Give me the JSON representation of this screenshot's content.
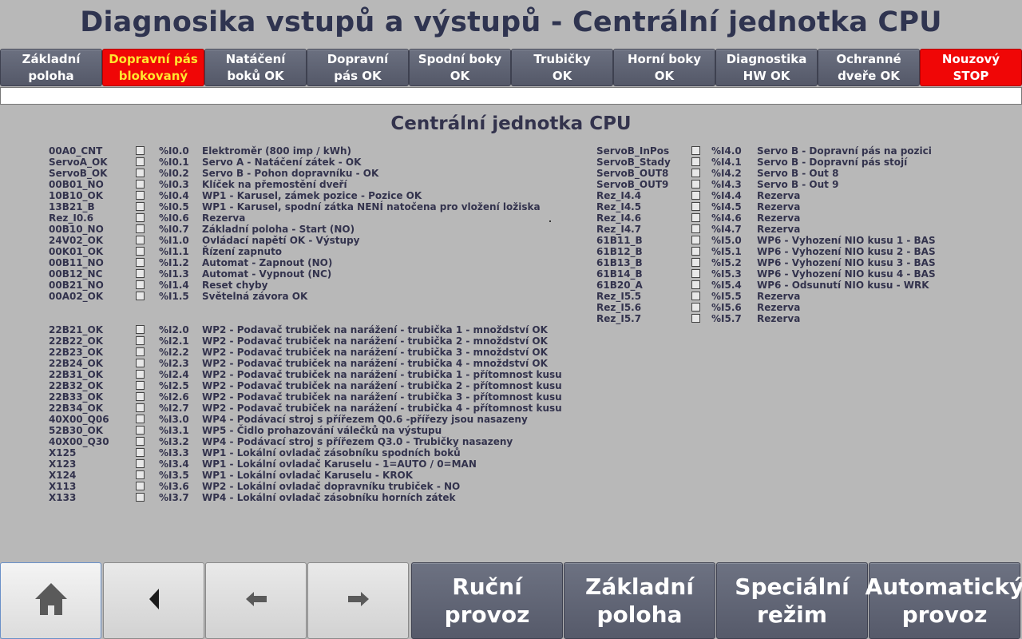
{
  "title": "Diagnosika vstupů a výstupů - Centrální jednotka CPU",
  "status_buttons": [
    {
      "label": "Základní\npoloha",
      "state": "normal"
    },
    {
      "label": "Dopravní pás\nblokovaný",
      "state": "warn"
    },
    {
      "label": "Natáčení\nboků OK",
      "state": "normal"
    },
    {
      "label": "Dopravní\npás OK",
      "state": "normal"
    },
    {
      "label": "Spodní boky\nOK",
      "state": "normal"
    },
    {
      "label": "Trubičky\nOK",
      "state": "normal"
    },
    {
      "label": "Horní boky\nOK",
      "state": "normal"
    },
    {
      "label": "Diagnostika\nHW OK",
      "state": "normal"
    },
    {
      "label": "Ochranné\ndveře OK",
      "state": "normal"
    },
    {
      "label": "Nouzový\nSTOP",
      "state": "stop"
    }
  ],
  "section_title": "Centrální jednotka CPU",
  "left_inputs_group1": [
    {
      "tag": "00A0_CNT",
      "address": "%I0.0",
      "description": "Elektroměr (800 imp / kWh)",
      "checked": false
    },
    {
      "tag": "ServoA_OK",
      "address": "%I0.1",
      "description": "Servo A - Natáčení zátek - OK",
      "checked": false
    },
    {
      "tag": "ServoB_OK",
      "address": "%I0.2",
      "description": "Servo B - Pohon dopravníku - OK",
      "checked": false
    },
    {
      "tag": "00B01_NO",
      "address": "%I0.3",
      "description": "Klíček na přemostění dveří",
      "checked": false
    },
    {
      "tag": "10B10_OK",
      "address": "%I0.4",
      "description": "WP1 - Karusel, zámek pozice - Pozice OK",
      "checked": false
    },
    {
      "tag": "13B21_B",
      "address": "%I0.5",
      "description": "WP1 - Karusel, spodní zátka NENÍ natočena pro vložení ložiska",
      "checked": false
    },
    {
      "tag": "Rez_I0.6",
      "address": "%I0.6",
      "description": "Rezerva",
      "checked": false
    },
    {
      "tag": "00B10_NO",
      "address": "%I0.7",
      "description": "Základní poloha - Start (NO)",
      "checked": false
    },
    {
      "tag": "24V02_OK",
      "address": "%I1.0",
      "description": "Ovládací napětí OK - Výstupy",
      "checked": false
    },
    {
      "tag": "00K01_OK",
      "address": "%I1.1",
      "description": "Řízení zapnuto",
      "checked": false
    },
    {
      "tag": "00B11_NO",
      "address": "%I1.2",
      "description": "Automat - Zapnout (NO)",
      "checked": false
    },
    {
      "tag": "00B12_NC",
      "address": "%I1.3",
      "description": "Automat - Vypnout (NC)",
      "checked": false
    },
    {
      "tag": "00B21_NO",
      "address": "%I1.4",
      "description": "Reset chyby",
      "checked": false
    },
    {
      "tag": "00A02_OK",
      "address": "%I1.5",
      "description": "Světelná závora OK",
      "checked": false
    }
  ],
  "left_inputs_group2": [
    {
      "tag": "22B21_OK",
      "address": "%I2.0",
      "description": "WP2 - Podavač trubiček na narážení - trubička 1 - množdství OK",
      "checked": false
    },
    {
      "tag": "22B22_OK",
      "address": "%I2.1",
      "description": "WP2 - Podavač trubiček na narážení - trubička 2 - množdství OK",
      "checked": false
    },
    {
      "tag": "22B23_OK",
      "address": "%I2.2",
      "description": "WP2 - Podavač trubiček na narážení - trubička 3 - množdství OK",
      "checked": false
    },
    {
      "tag": "22B24_OK",
      "address": "%I2.3",
      "description": "WP2 - Podavač trubiček na narážení - trubička 4 - množdství OK",
      "checked": false
    },
    {
      "tag": "22B31_OK",
      "address": "%I2.4",
      "description": "WP2 - Podavač trubiček na narážení - trubička 1 - přítomnost kusu",
      "checked": false
    },
    {
      "tag": "22B32_OK",
      "address": "%I2.5",
      "description": "WP2 - Podavač trubiček na narážení - trubička 2 - přítomnost kusu",
      "checked": false
    },
    {
      "tag": "22B33_OK",
      "address": "%I2.6",
      "description": "WP2 - Podavač trubiček na narážení - trubička 3 - přítomnost kusu",
      "checked": false
    },
    {
      "tag": "22B34_OK",
      "address": "%I2.7",
      "description": "WP2 - Podavač trubiček na narážení - trubička 4 - přítomnost kusu",
      "checked": false
    },
    {
      "tag": "40X00_Q06",
      "address": "%I3.0",
      "description": "WP4 - Podávací stroj s přířezem Q0.6 -přířezy jsou nasazeny",
      "checked": false
    },
    {
      "tag": "52B30_OK",
      "address": "%I3.1",
      "description": "WP5 - Čidlo prohazování válečků na výstupu",
      "checked": false
    },
    {
      "tag": "40X00_Q30",
      "address": "%I3.2",
      "description": "WP4 - Podávací stroj s přířezem Q3.0 - Trubičky nasazeny",
      "checked": false
    },
    {
      "tag": "X125",
      "address": "%I3.3",
      "description": "WP1 - Lokální ovladač zásobníku spodních boků",
      "checked": false
    },
    {
      "tag": "X123",
      "address": "%I3.4",
      "description": "WP1 - Lokální ovladač Karuselu - 1=AUTO / 0=MAN",
      "checked": false
    },
    {
      "tag": "X124",
      "address": "%I3.5",
      "description": "WP1 - Lokální ovladač Karuselu - KROK",
      "checked": false
    },
    {
      "tag": "X113",
      "address": "%I3.6",
      "description": "WP2 - Lokální ovladač dopravníku trubiček - NO",
      "checked": false
    },
    {
      "tag": "X133",
      "address": "%I3.7",
      "description": "WP4 - Lokální ovladač zásobníku horních zátek",
      "checked": false
    }
  ],
  "right_inputs": [
    {
      "tag": "ServoB_InPos",
      "address": "%I4.0",
      "description": "Servo B - Dopravní pás na pozici",
      "checked": false
    },
    {
      "tag": "ServoB_Stady",
      "address": "%I4.1",
      "description": "Servo B - Dopravní pás stojí",
      "checked": false
    },
    {
      "tag": "ServoB_OUT8",
      "address": "%I4.2",
      "description": "Servo B - Out 8",
      "checked": false
    },
    {
      "tag": "ServoB_OUT9",
      "address": "%I4.3",
      "description": "Servo B - Out 9",
      "checked": false
    },
    {
      "tag": "Rez_I4.4",
      "address": "%I4.4",
      "description": "Rezerva",
      "checked": false
    },
    {
      "tag": "Rez_I4.5",
      "address": "%I4.5",
      "description": "Rezerva",
      "checked": false
    },
    {
      "tag": "Rez_I4.6",
      "address": "%I4.6",
      "description": "Rezerva",
      "checked": false
    },
    {
      "tag": "Rez_I4.7",
      "address": "%I4.7",
      "description": "Rezerva",
      "checked": false
    },
    {
      "tag": "61B11_B",
      "address": "%I5.0",
      "description": "WP6 - Vyhození NIO kusu 1 - BAS",
      "checked": false
    },
    {
      "tag": "61B12_B",
      "address": "%I5.1",
      "description": "WP6 - Vyhození NIO kusu 2 - BAS",
      "checked": false
    },
    {
      "tag": "61B13_B",
      "address": "%I5.2",
      "description": "WP6 - Vyhození NIO kusu 3 - BAS",
      "checked": false
    },
    {
      "tag": "61B14_B",
      "address": "%I5.3",
      "description": "WP6 - Vyhození NIO kusu 4 - BAS",
      "checked": false
    },
    {
      "tag": "61B20_A",
      "address": "%I5.4",
      "description": "WP6 - Odsunutí NIO kusu - WRK",
      "checked": false
    },
    {
      "tag": "Rez_I5.5",
      "address": "%I5.5",
      "description": "Rezerva",
      "checked": false
    },
    {
      "tag": "Rez_I5.6",
      "address": "%I5.6",
      "description": "Rezerva",
      "checked": false
    },
    {
      "tag": "Rez_I5.7",
      "address": "%I5.7",
      "description": "Rezerva",
      "checked": false
    }
  ],
  "nav_buttons": [
    {
      "name": "home-button",
      "icon": "home-icon"
    },
    {
      "name": "back-button",
      "icon": "triangle-left-icon"
    },
    {
      "name": "previous-page-button",
      "icon": "arrow-left-icon"
    },
    {
      "name": "next-page-button",
      "icon": "arrow-right-icon"
    }
  ],
  "mode_buttons": [
    {
      "label": "Ruční\nprovoz"
    },
    {
      "label": "Základní\npoloha"
    },
    {
      "label": "Speciální\nrežim"
    },
    {
      "label": "Automatický\nprovoz"
    }
  ],
  "colors": {
    "background": "#b8b8b8",
    "text": "#33334d",
    "button": "#5d6172",
    "warn_bg": "#f00606",
    "warn_text": "#ffe52e"
  }
}
